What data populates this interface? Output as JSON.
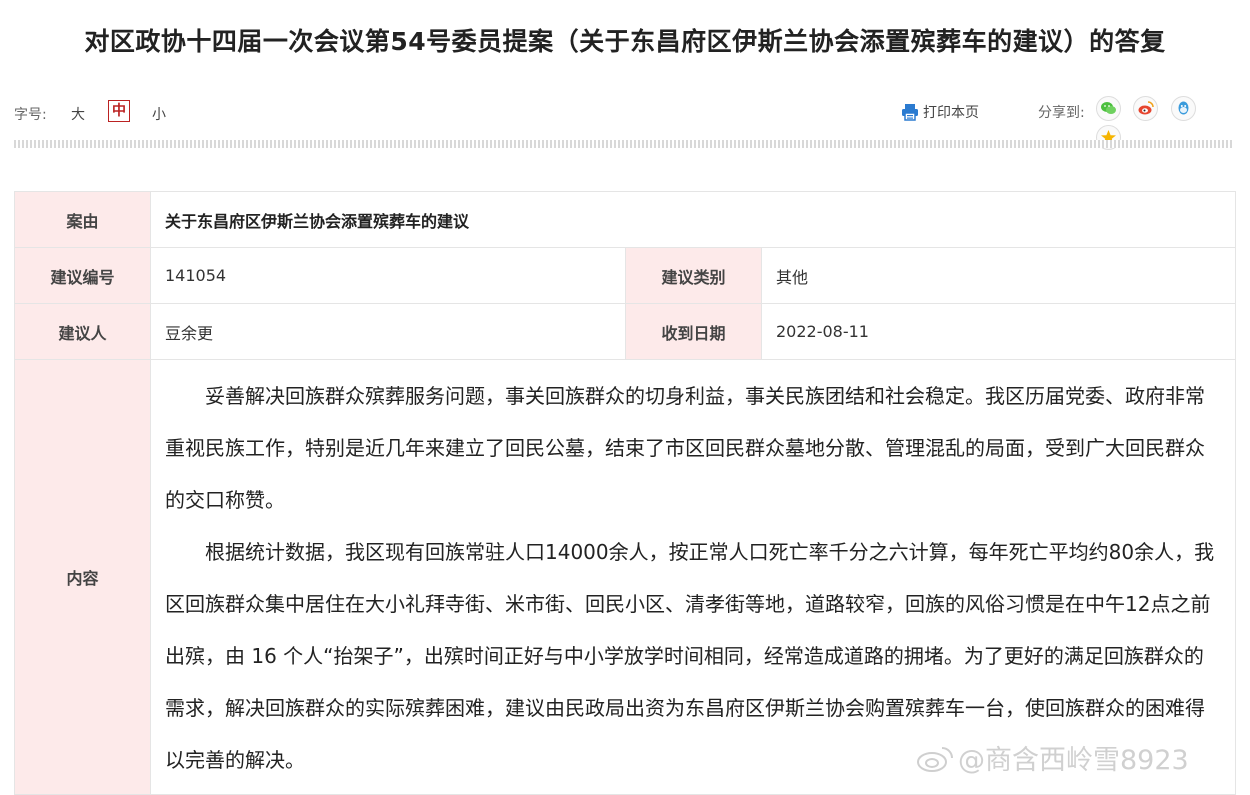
{
  "title": "对区政协十四届一次会议第54号委员提案（关于东昌府区伊斯兰协会添置殡葬车的建议）的答复",
  "toolbar": {
    "font_size_label": "字号:",
    "font_large": "大",
    "font_medium": "中",
    "font_small": "小",
    "print_label": "打印本页",
    "share_label": "分享到:",
    "share_icons": [
      "wechat-icon",
      "weibo-icon",
      "qq-icon",
      "qzone-icon"
    ]
  },
  "table": {
    "reason_label": "案由",
    "reason_value": "关于东昌府区伊斯兰协会添置殡葬车的建议",
    "number_label": "建议编号",
    "number_value": "141054",
    "category_label": "建议类别",
    "category_value": "其他",
    "proposer_label": "建议人",
    "proposer_value": "豆余更",
    "date_label": "收到日期",
    "date_value": "2022-08-11",
    "content_label": "内容",
    "paragraphs": [
      "妥善解决回族群众殡葬服务问题，事关回族群众的切身利益，事关民族团结和社会稳定。我区历届党委、政府非常重视民族工作，特别是近几年来建立了回民公墓，结束了市区回民群众墓地分散、管理混乱的局面，受到广大回民群众的交口称赞。",
      "根据统计数据，我区现有回族常驻人口14000余人，按正常人口死亡率千分之六计算，每年死亡平均约80余人，我区回族群众集中居住在大小礼拜寺街、米市街、回民小区、清孝街等地，道路较窄，回族的风俗习惯是在中午12点之前出殡，由 16 个人“抬架子”，出殡时间正好与中小学放学时间相同，经常造成道路的拥堵。为了更好的满足回族群众的需求，解决回族群众的实际殡葬困难，建议由民政局出资为东昌府区伊斯兰协会购置殡葬车一台，使回族群众的困难得以完善的解决。"
    ]
  },
  "watermark": "@商含西岭雪8923",
  "colors": {
    "label_bg": "#fdeaea",
    "accent_red": "#b22222",
    "print_blue": "#2b7bd0"
  }
}
